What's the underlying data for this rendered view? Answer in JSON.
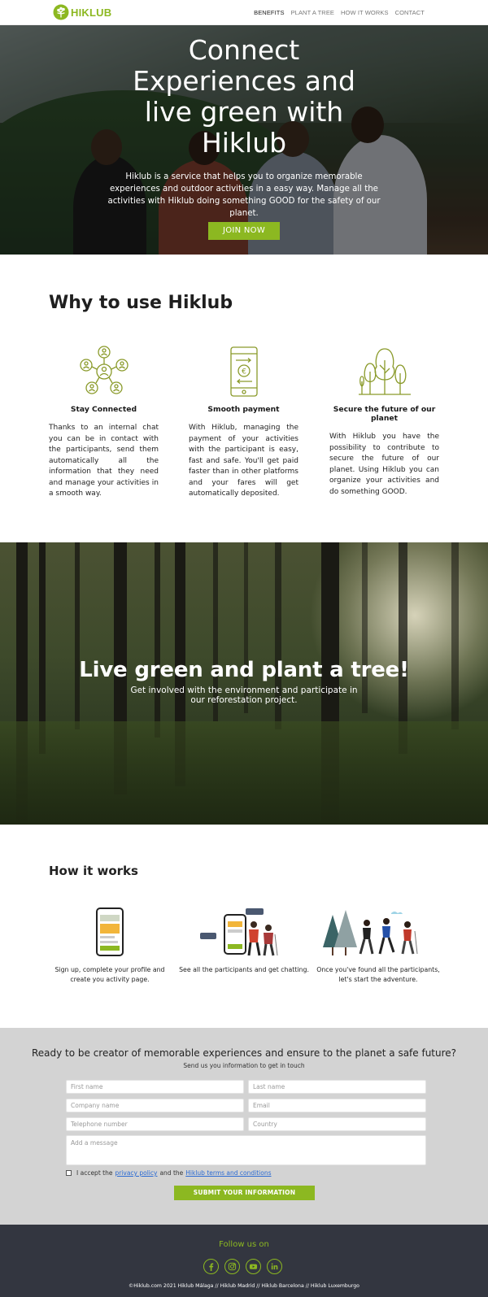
{
  "brand": {
    "logo_hi": "HI",
    "logo_klub": "KLUB",
    "accent": "#8cb821",
    "icon": "tree-logo-icon"
  },
  "nav": {
    "items": [
      {
        "label": "BENEFITS",
        "active": true
      },
      {
        "label": "PLANT A TREE",
        "active": false
      },
      {
        "label": "HOW IT WORKS",
        "active": false
      },
      {
        "label": "CONTACT",
        "active": false
      }
    ]
  },
  "hero": {
    "title": "Connect Experiences and live green with Hiklub",
    "text": "Hiklub is a service that helps you to organize memorable experiences and outdoor activities in a easy way. Manage all the activities with Hiklub doing something GOOD for the safety of our planet.",
    "button": "JOIN NOW"
  },
  "why": {
    "title": "Why to use Hiklub",
    "features": [
      {
        "icon": "network-people-icon",
        "title": "Stay Connected",
        "text": "Thanks to an internal chat you can be in contact with the participants, send them automatically all the information that they need and manage your activities in a smooth way."
      },
      {
        "icon": "mobile-payment-icon",
        "title": "Smooth payment",
        "text": "With Hiklub, managing the payment of your activities with the participant is easy, fast and safe. You'll get paid faster than in other platforms and your fares will get automatically deposited."
      },
      {
        "icon": "trees-icon",
        "title": "Secure the future of our planet",
        "text": "With Hiklub you have the possibility to contribute to secure the future of our planet. Using Hiklub you can organize your activities and do something GOOD."
      }
    ]
  },
  "plant": {
    "title": "Live green and plant a tree!",
    "subtitle": "Get involved with the environment and participate in our reforestation project."
  },
  "how": {
    "title": "How it works",
    "steps": [
      {
        "icon": "phone-profile-illustration",
        "text": "Sign up, complete your profile and create you activity page."
      },
      {
        "icon": "chat-participants-illustration",
        "text": "See all the participants and get chatting."
      },
      {
        "icon": "hikers-adventure-illustration",
        "text": "Once you've found all the participants, let's start the adventure."
      }
    ]
  },
  "contact": {
    "title": "Ready to be creator of memorable experiences and ensure to the planet a safe future?",
    "subtitle": "Send us you information to get in touch",
    "placeholders": {
      "first_name": "First name",
      "last_name": "Last name",
      "company": "Company name",
      "email": "Email",
      "phone": "Telephone number",
      "country": "Country",
      "message": "Add a message"
    },
    "agree_prefix": "I accept the",
    "privacy_link": "privacy policy",
    "agree_mid": "and the",
    "terms_link": "Hiklub terms and conditions",
    "submit": "SUBMIT YOUR INFORMATION"
  },
  "footer": {
    "follow": "Follow us on",
    "socials": [
      "facebook-icon",
      "instagram-icon",
      "youtube-icon",
      "linkedin-icon"
    ],
    "copyright": "©Hiklub.com 2021    Hiklub Málaga // Hiklub Madrid // Hiklub Barcelona // Hiklub Luxemburgo"
  }
}
